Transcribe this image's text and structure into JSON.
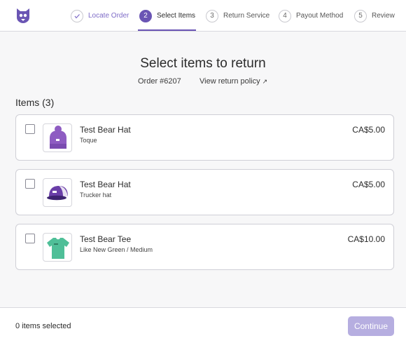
{
  "stepper": {
    "steps": [
      {
        "number": "",
        "label": "Locate Order",
        "state": "done"
      },
      {
        "number": "2",
        "label": "Select Items",
        "state": "active"
      },
      {
        "number": "3",
        "label": "Return Service",
        "state": "upcoming"
      },
      {
        "number": "4",
        "label": "Payout Method",
        "state": "upcoming"
      },
      {
        "number": "5",
        "label": "Review",
        "state": "upcoming"
      }
    ]
  },
  "main": {
    "title": "Select items to return",
    "order_number": "Order #6207",
    "policy_link": "View return policy",
    "policy_arrow": "↗",
    "items_heading": "Items (3)",
    "items": [
      {
        "name": "Test Bear Hat",
        "variant": "Toque",
        "price": "CA$5.00",
        "thumb_icon": "toque-hat-icon",
        "checked": false
      },
      {
        "name": "Test Bear Hat",
        "variant": "Trucker hat",
        "price": "CA$5.00",
        "thumb_icon": "trucker-hat-icon",
        "checked": false
      },
      {
        "name": "Test Bear Tee",
        "variant": "Like New Green / Medium",
        "price": "CA$10.00",
        "thumb_icon": "tshirt-icon",
        "checked": false
      }
    ]
  },
  "footer": {
    "selected_count": "0 items selected",
    "continue_label": "Continue"
  },
  "colors": {
    "accent": "#6a55b4",
    "accent_light": "#b6aee0",
    "toque": "#8e5cc2",
    "trucker": "#6a3fa8",
    "tee": "#4fbf98"
  }
}
